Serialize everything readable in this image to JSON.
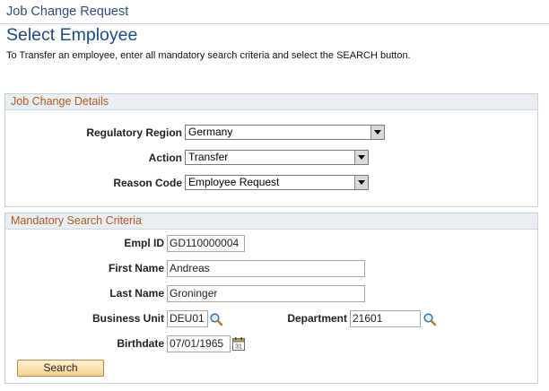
{
  "header": {
    "breadcrumb": "Job Change Request",
    "title": "Select Employee",
    "instructions": "To Transfer an employee, enter all mandatory search criteria and select the SEARCH button."
  },
  "job_change_details": {
    "heading": "Job Change Details",
    "regulatory_region": {
      "label": "Regulatory Region",
      "value": "Germany"
    },
    "action": {
      "label": "Action",
      "value": "Transfer"
    },
    "reason_code": {
      "label": "Reason Code",
      "value": "Employee Request"
    }
  },
  "search_criteria": {
    "heading": "Mandatory Search Criteria",
    "empl_id": {
      "label": "Empl ID",
      "value": "GD110000004"
    },
    "first_name": {
      "label": "First Name",
      "value": "Andreas"
    },
    "last_name": {
      "label": "Last Name",
      "value": "Groninger"
    },
    "business_unit": {
      "label": "Business Unit",
      "value": "DEU01"
    },
    "department": {
      "label": "Department",
      "value": "21601"
    },
    "birthdate": {
      "label": "Birthdate",
      "value": "07/01/1965"
    }
  },
  "buttons": {
    "search_label": "Search"
  },
  "icons": {
    "lookup": "magnifier-icon",
    "calendar": "calendar-icon"
  },
  "colors": {
    "title": "#1e4b86",
    "section_heading": "#b2581c",
    "button": "#f5d28f"
  }
}
